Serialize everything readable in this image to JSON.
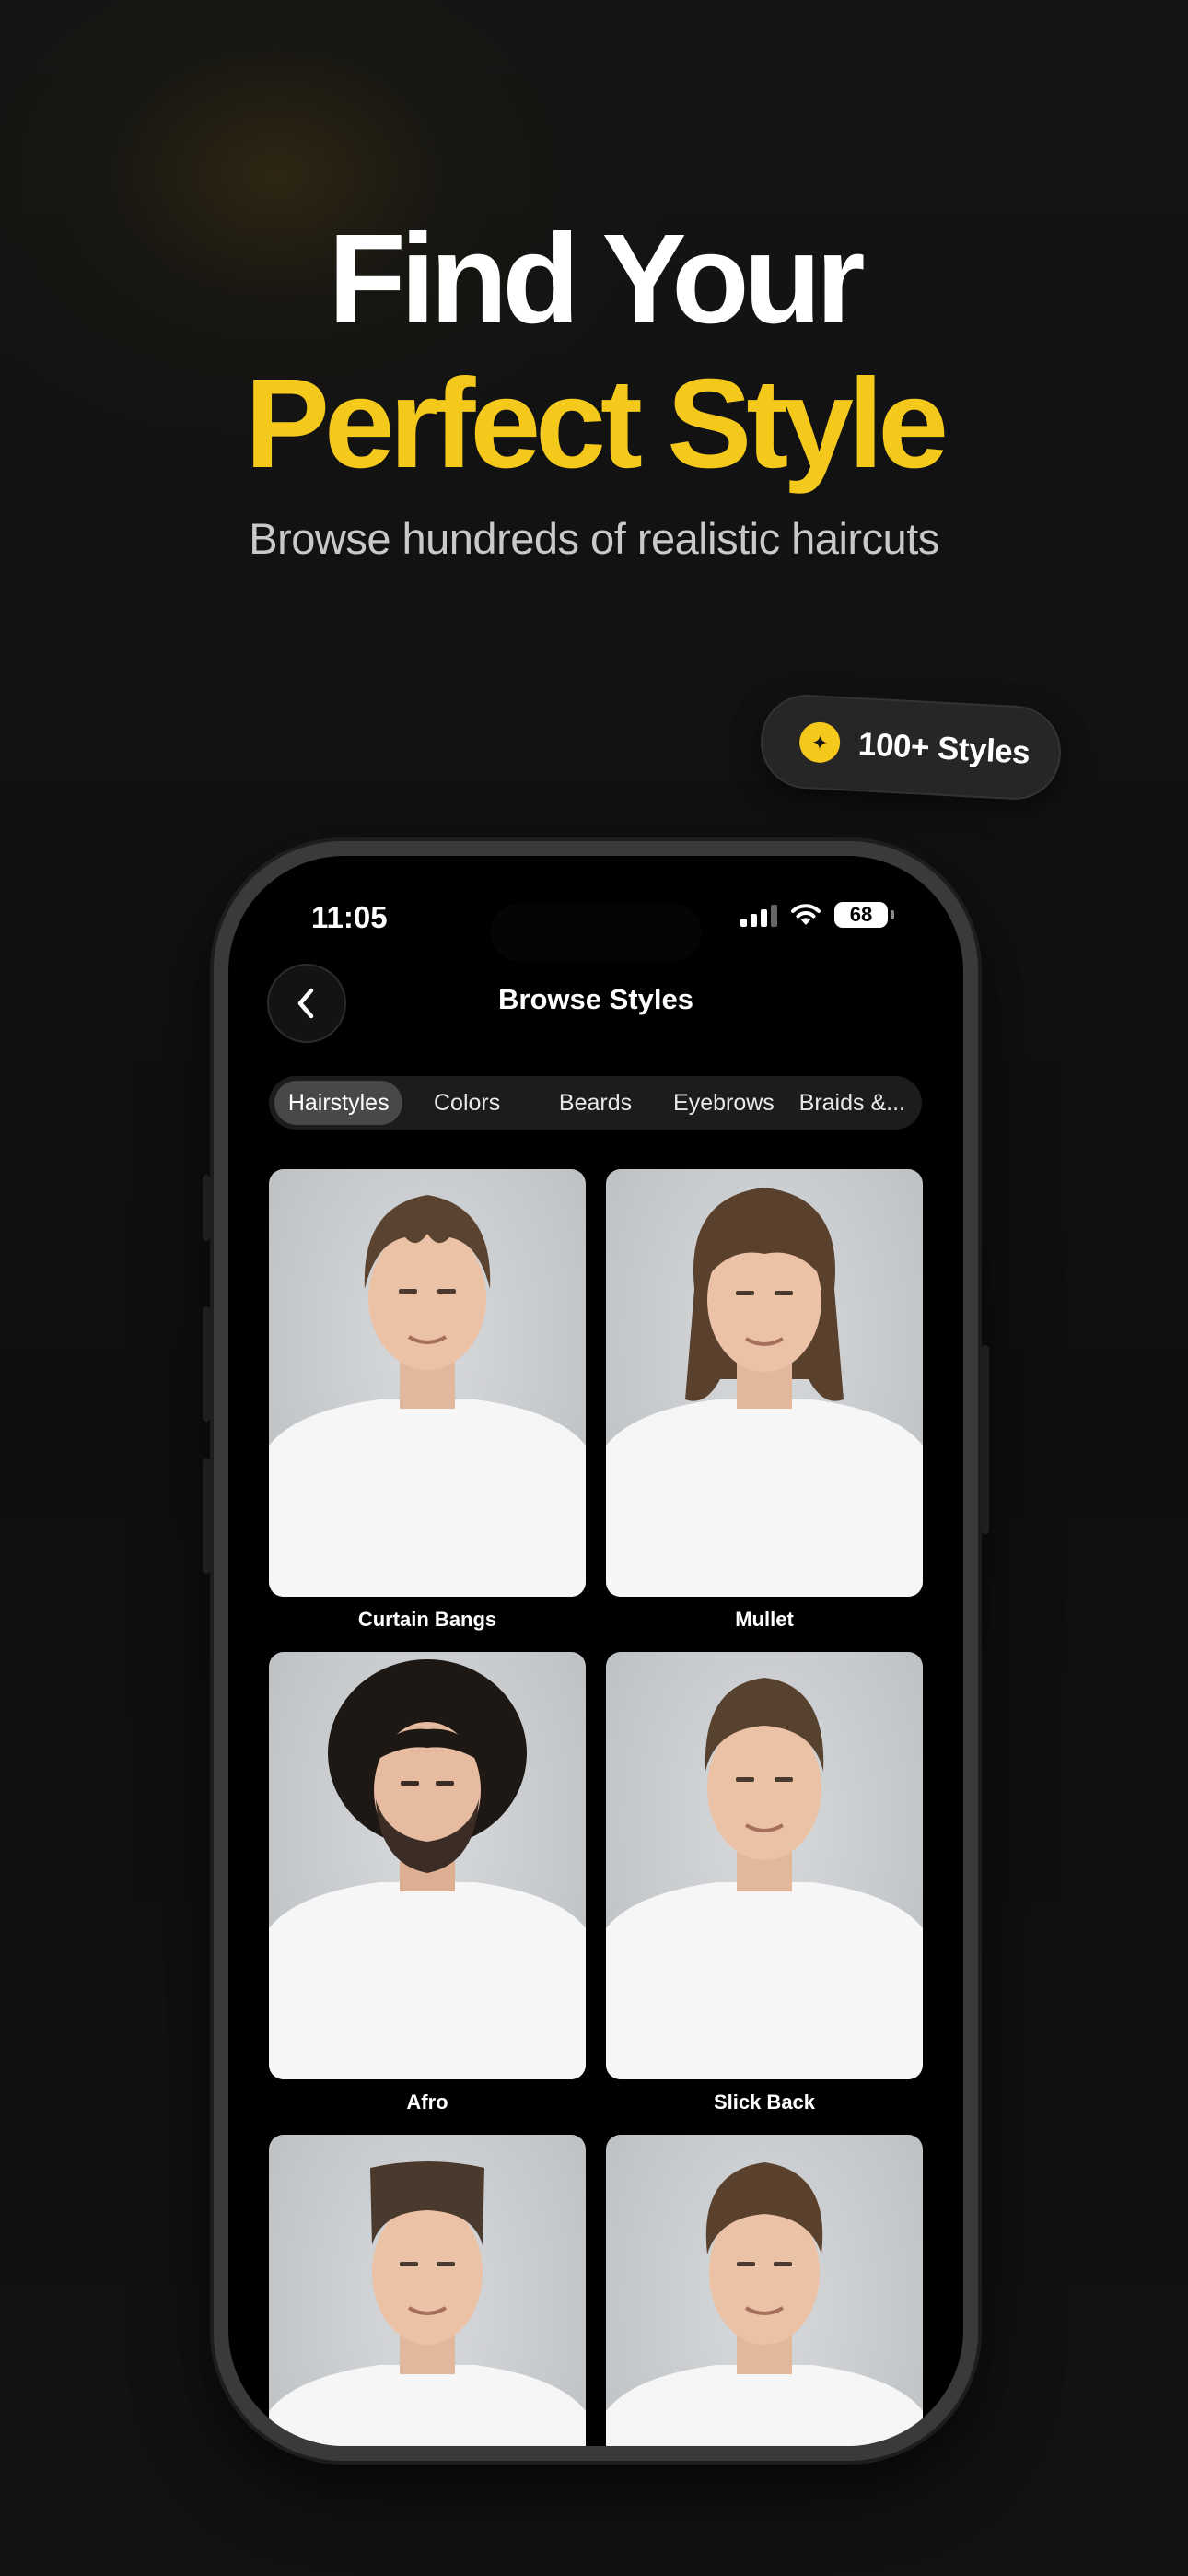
{
  "hero": {
    "line1": "Find Your",
    "line2": "Perfect Style",
    "subtitle": "Browse hundreds of realistic haircuts",
    "accent_color": "#f4c91c"
  },
  "badge": {
    "icon": "sparkle-icon",
    "label": "100+ Styles"
  },
  "status_bar": {
    "time": "11:05",
    "battery": "68"
  },
  "nav": {
    "back_icon": "chevron-left-icon",
    "title": "Browse Styles"
  },
  "tabs": [
    {
      "label": "Hairstyles",
      "active": true
    },
    {
      "label": "Colors",
      "active": false
    },
    {
      "label": "Beards",
      "active": false
    },
    {
      "label": "Eyebrows",
      "active": false
    },
    {
      "label": "Braids &...",
      "active": false
    }
  ],
  "styles": [
    {
      "label": "Curtain Bangs"
    },
    {
      "label": "Mullet"
    },
    {
      "label": "Afro"
    },
    {
      "label": "Slick Back"
    },
    {
      "label": ""
    },
    {
      "label": ""
    }
  ]
}
